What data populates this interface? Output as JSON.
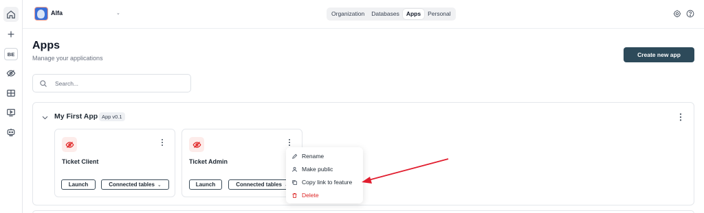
{
  "topbar": {
    "org_name": "Alfa",
    "tabs": [
      {
        "label": "Organization",
        "active": false
      },
      {
        "label": "Databases",
        "active": false
      },
      {
        "label": "Apps",
        "active": true
      },
      {
        "label": "Personal",
        "active": false
      }
    ],
    "icons": [
      "settings-gear-icon",
      "help-circle-icon"
    ]
  },
  "sidebar": {
    "items": [
      {
        "icon": "home-icon"
      },
      {
        "icon": "plus-icon"
      },
      {
        "badge": "BE"
      },
      {
        "icon": "eye-off-icon"
      },
      {
        "icon": "table-grid-icon"
      },
      {
        "icon": "video-play-icon"
      },
      {
        "icon": "bot-icon"
      }
    ]
  },
  "header": {
    "title": "Apps",
    "subtitle": "Manage your applications",
    "create_button": "Create new app"
  },
  "search": {
    "placeholder": "Search..."
  },
  "section": {
    "title": "My First App",
    "version": "App v0.1",
    "apps": [
      {
        "name": "Ticket Client",
        "launch_label": "Launch",
        "tables_label": "Connected tables"
      },
      {
        "name": "Ticket Admin",
        "launch_label": "Launch",
        "tables_label": "Connected tables"
      }
    ]
  },
  "context_menu": {
    "items": [
      {
        "label": "Rename",
        "icon": "pencil-icon"
      },
      {
        "label": "Make public",
        "icon": "user-icon"
      },
      {
        "label": "Copy link to feature",
        "icon": "copy-icon"
      },
      {
        "label": "Delete",
        "icon": "trash-icon",
        "danger": true
      }
    ]
  },
  "colors": {
    "primary_button": "#2d4a5a",
    "danger": "#dc2626",
    "app_icon": "#e02424",
    "annotation_arrow": "#e11d2e"
  }
}
